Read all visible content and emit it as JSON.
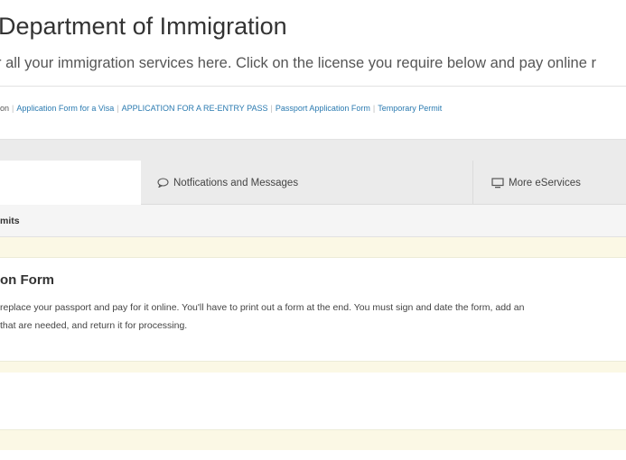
{
  "header": {
    "title": "Department of Immigration",
    "subtitle": "r all your immigration services here. Click on the license you require below and pay online r"
  },
  "quick_links": {
    "lead": "on",
    "items": [
      "Application Form for a Visa",
      "APPLICATION FOR A RE-ENTRY PASS",
      "Passport Application Form",
      "Temporary Permit"
    ]
  },
  "tabs": {
    "notifications": {
      "label": "Notfications and Messages",
      "icon": "chat-bubble-icon"
    },
    "more": {
      "label": "More eServices",
      "icon": "monitor-icon"
    }
  },
  "section": {
    "label": "mits"
  },
  "card": {
    "title": "on Form",
    "desc_line1": "replace your passport and pay for it online. You'll have to print out a form at the end. You must sign and date the form, add an",
    "desc_line2": "that are needed, and return it for processing."
  },
  "colors": {
    "link": "#2a7ab0",
    "tab_bg": "#ebebeb",
    "cream": "#fbf8e5"
  }
}
